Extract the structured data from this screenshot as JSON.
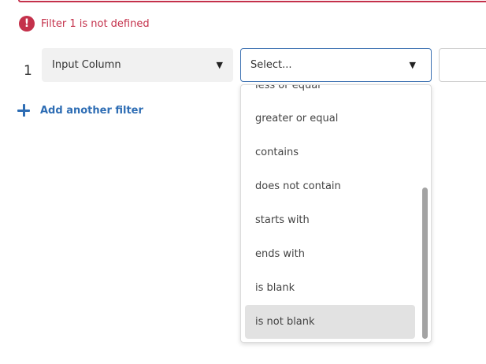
{
  "error": {
    "icon": "!",
    "message": "Filter 1 is not defined"
  },
  "filter_row": {
    "index": "1",
    "column_select": {
      "label": "Input Column",
      "caret": "▼"
    },
    "operator_select": {
      "label": "Select...",
      "caret": "▼"
    },
    "value_input": {
      "value": ""
    }
  },
  "add_filter": {
    "label": "Add another filter"
  },
  "operator_options": [
    "less or equal",
    "greater or equal",
    "contains",
    "does not contain",
    "starts with",
    "ends with",
    "is blank",
    "is not blank"
  ],
  "selected_option": "is not blank",
  "colors": {
    "error": "#c4314b",
    "accent": "#2e6db4",
    "focus_border": "#3f73b3"
  }
}
